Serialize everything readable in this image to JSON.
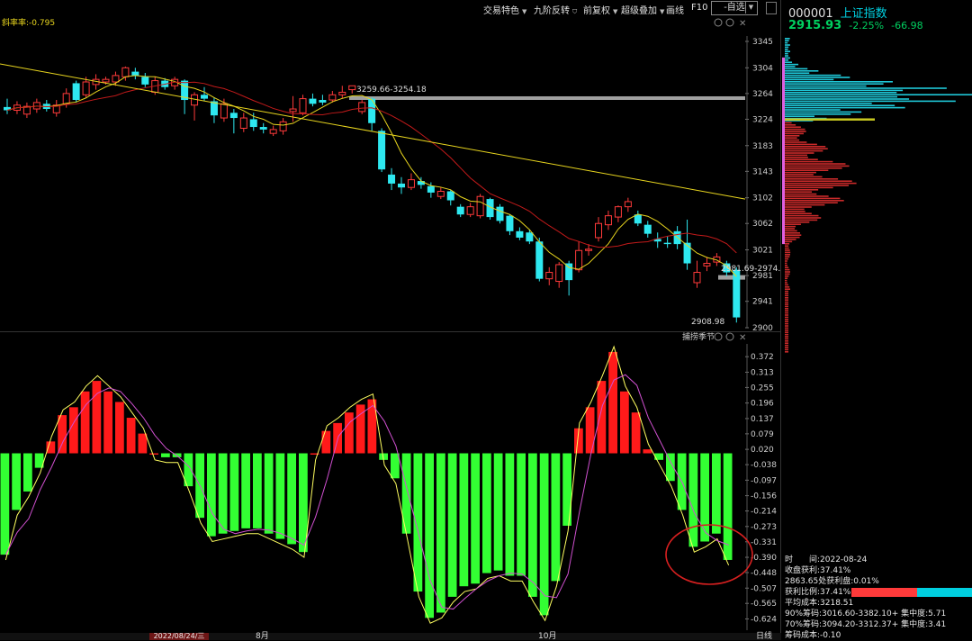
{
  "toolbar": {
    "items": [
      "交易特色",
      "九阶反转",
      "前复权",
      "超级叠加",
      "画线",
      "F10"
    ],
    "self_select": "-自选"
  },
  "upper_panel": {
    "indicator_label": "斜率率:-0.795",
    "resistance_label": "3259.66-3254.18",
    "support_label": "2981.69-2974.24",
    "low_label": "2908.98",
    "y_ticks": [
      "3345",
      "3304",
      "3264",
      "3224",
      "3183",
      "3143",
      "3102",
      "3062",
      "3021",
      "2981",
      "2941",
      "2900"
    ]
  },
  "lower_panel": {
    "title": "捕捞季节",
    "y_ticks": [
      "0.372",
      "0.313",
      "0.255",
      "0.196",
      "0.137",
      "0.079",
      "0.020",
      "-0.038",
      "-0.097",
      "-0.156",
      "-0.214",
      "-0.273",
      "-0.331",
      "-0.390",
      "-0.448",
      "-0.507",
      "-0.565",
      "-0.624"
    ]
  },
  "side": {
    "code": "000001",
    "name": "上证指数",
    "price": "2915.93",
    "change_pct": "-2.25%",
    "change": "-66.98",
    "stats": [
      "时　　间:2022-08-24",
      "收盘获利:37.41%",
      "2863.65处获利盘:0.01%",
      "获利比例:37.41%",
      "平均成本:3218.51",
      "90%筹码:3016.60-3382.10+ 集中度:5.71",
      "70%筹码:3094.20-3312.37+ 集中度:3.41",
      "筹码成本:-0.10"
    ],
    "profit_ratio": 0.3741
  },
  "bottom": {
    "date_chip": "2022/08/24/三",
    "month_1": "8月",
    "month_2": "10月",
    "period": "日线"
  },
  "colors": {
    "up": "#ff3a3a",
    "down": "#2ee8f0",
    "macd_pos": "#ff1a1a",
    "macd_neg": "#33ff33",
    "ma_yellow": "#e8d51e",
    "ma_red": "#c21a1a",
    "profile_up": "#1fc8d8",
    "profile_down": "#c92a2a"
  },
  "chart_data": [
    {
      "type": "candlestick",
      "ylim": [
        2900,
        3345
      ],
      "candles": [
        [
          3243,
          3238,
          3256,
          3232
        ],
        [
          3238,
          3246,
          3252,
          3232
        ],
        [
          3232,
          3244,
          3250,
          3226
        ],
        [
          3240,
          3250,
          3256,
          3234
        ],
        [
          3248,
          3240,
          3254,
          3236
        ],
        [
          3234,
          3246,
          3254,
          3228
        ],
        [
          3248,
          3264,
          3272,
          3242
        ],
        [
          3280,
          3254,
          3284,
          3250
        ],
        [
          3262,
          3282,
          3290,
          3258
        ],
        [
          3278,
          3286,
          3294,
          3270
        ],
        [
          3282,
          3286,
          3290,
          3278
        ],
        [
          3282,
          3292,
          3298,
          3276
        ],
        [
          3290,
          3304,
          3306,
          3284
        ],
        [
          3298,
          3292,
          3304,
          3286
        ],
        [
          3290,
          3278,
          3296,
          3274
        ],
        [
          3266,
          3284,
          3290,
          3262
        ],
        [
          3284,
          3274,
          3288,
          3270
        ],
        [
          3276,
          3286,
          3290,
          3270
        ],
        [
          3284,
          3254,
          3286,
          3232
        ],
        [
          3246,
          3262,
          3266,
          3222
        ],
        [
          3262,
          3256,
          3274,
          3252
        ],
        [
          3252,
          3230,
          3258,
          3218
        ],
        [
          3226,
          3248,
          3256,
          3220
        ],
        [
          3234,
          3226,
          3240,
          3202
        ],
        [
          3210,
          3226,
          3234,
          3204
        ],
        [
          3224,
          3212,
          3234,
          3206
        ],
        [
          3212,
          3208,
          3218,
          3202
        ],
        [
          3202,
          3208,
          3214,
          3198
        ],
        [
          3206,
          3220,
          3226,
          3200
        ],
        [
          3236,
          3240,
          3260,
          3220
        ],
        [
          3234,
          3256,
          3262,
          3230
        ],
        [
          3256,
          3248,
          3264,
          3244
        ],
        [
          3254,
          3250,
          3262,
          3246
        ],
        [
          3254,
          3262,
          3268,
          3250
        ],
        [
          3262,
          3266,
          3276,
          3256
        ],
        [
          3270,
          3276,
          3276,
          3264
        ],
        [
          3236,
          3250,
          3254,
          3232
        ],
        [
          3256,
          3218,
          3258,
          3206
        ],
        [
          3206,
          3146,
          3210,
          3142
        ],
        [
          3138,
          3124,
          3148,
          3114
        ],
        [
          3124,
          3118,
          3134,
          3108
        ],
        [
          3118,
          3130,
          3140,
          3114
        ],
        [
          3128,
          3122,
          3134,
          3116
        ],
        [
          3120,
          3110,
          3126,
          3102
        ],
        [
          3104,
          3112,
          3118,
          3100
        ],
        [
          3112,
          3098,
          3114,
          3090
        ],
        [
          3088,
          3076,
          3092,
          3072
        ],
        [
          3076,
          3088,
          3094,
          3072
        ],
        [
          3074,
          3104,
          3108,
          3070
        ],
        [
          3100,
          3072,
          3102,
          3068
        ],
        [
          3088,
          3066,
          3092,
          3062
        ],
        [
          3074,
          3050,
          3076,
          3044
        ],
        [
          3050,
          3040,
          3056,
          3036
        ],
        [
          3048,
          3034,
          3052,
          3030
        ],
        [
          3034,
          2976,
          3040,
          2972
        ],
        [
          2976,
          2986,
          2994,
          2966
        ],
        [
          2972,
          2998,
          3002,
          2962
        ],
        [
          3000,
          2974,
          3004,
          2950
        ],
        [
          2990,
          3020,
          3034,
          2986
        ],
        [
          3020,
          3022,
          3030,
          3012
        ],
        [
          3040,
          3062,
          3072,
          3034
        ],
        [
          3060,
          3074,
          3082,
          3052
        ],
        [
          3072,
          3088,
          3090,
          3064
        ],
        [
          3088,
          3096,
          3102,
          3080
        ],
        [
          3076,
          3062,
          3082,
          3058
        ],
        [
          3060,
          3046,
          3066,
          3040
        ],
        [
          3038,
          3034,
          3048,
          3024
        ],
        [
          3032,
          3030,
          3042,
          3024
        ],
        [
          3050,
          3030,
          3058,
          3022
        ],
        [
          3032,
          3000,
          3068,
          2990
        ],
        [
          2970,
          2986,
          3004,
          2962
        ],
        [
          2996,
          3000,
          3010,
          2988
        ],
        [
          3002,
          3010,
          3016,
          2996
        ],
        [
          3000,
          2986,
          3004,
          2980
        ],
        [
          2990,
          2916,
          2994,
          2908
        ]
      ]
    },
    {
      "type": "bar",
      "title": "捕捞季节",
      "ylim": [
        -0.66,
        0.4
      ],
      "values": [
        -0.38,
        -0.21,
        -0.14,
        -0.05,
        0.05,
        0.15,
        0.18,
        0.24,
        0.28,
        0.24,
        0.2,
        0.14,
        0.08,
        0.0,
        -0.01,
        -0.01,
        -0.12,
        -0.24,
        -0.31,
        -0.3,
        -0.29,
        -0.28,
        -0.28,
        -0.3,
        -0.32,
        -0.34,
        -0.37,
        0.0,
        0.09,
        0.12,
        0.16,
        0.19,
        0.21,
        -0.02,
        -0.09,
        -0.3,
        -0.52,
        -0.62,
        -0.6,
        -0.54,
        -0.5,
        -0.49,
        -0.45,
        -0.44,
        -0.46,
        -0.46,
        -0.54,
        -0.61,
        -0.48,
        -0.27,
        0.1,
        0.18,
        0.28,
        0.39,
        0.24,
        0.16,
        0.02,
        -0.02,
        -0.1,
        -0.21,
        -0.35,
        -0.33,
        -0.3,
        -0.4
      ]
    }
  ]
}
